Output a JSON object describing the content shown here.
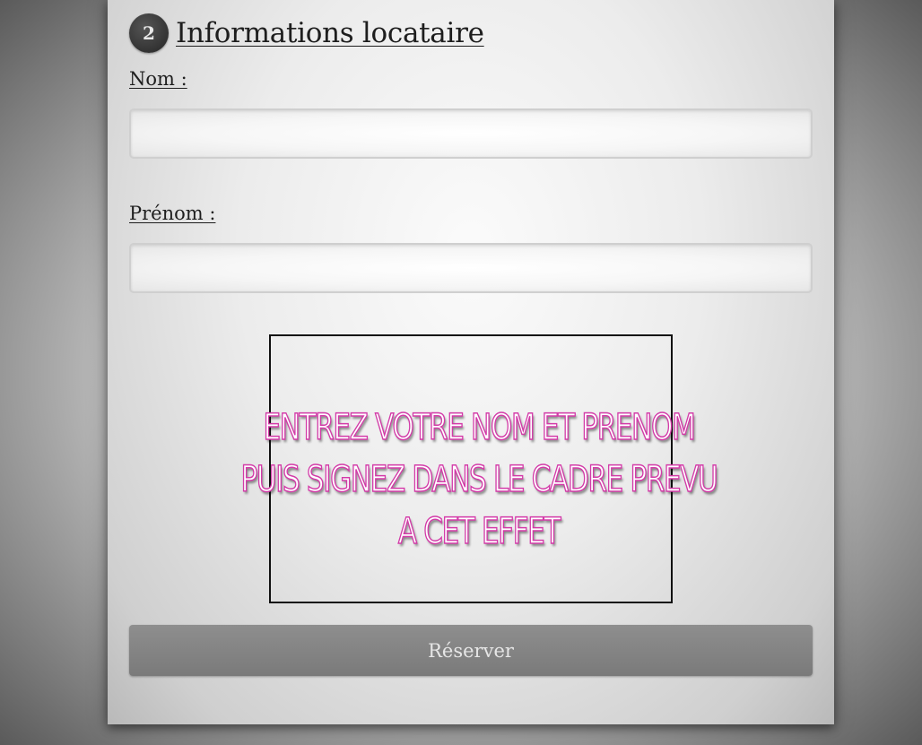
{
  "section": {
    "step_number": "2",
    "title": "Informations locataire"
  },
  "fields": {
    "nom_label": "Nom :",
    "nom_value": "",
    "prenom_label": "Prénom :",
    "prenom_value": ""
  },
  "signature": {
    "instructions": [
      "ENTREZ VOTRE NOM ET PRENOM",
      "PUIS SIGNEZ DANS LE CADRE PREVU",
      "A CET EFFET"
    ]
  },
  "actions": {
    "submit_label": "Réserver"
  },
  "colors": {
    "overlay_text_fill": "#ffffff",
    "overlay_text_stroke": "#d33aa8",
    "button_background": "#8e8e8e",
    "badge_background": "#333333"
  }
}
